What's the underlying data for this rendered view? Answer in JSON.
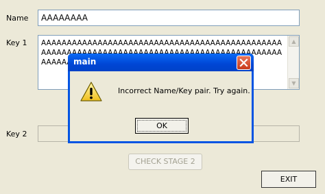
{
  "form": {
    "name_label": "Name",
    "name_value": "AAAAAAAA",
    "key1_label": "Key 1",
    "key1_value": "AAAAAAAAAAAAAAAAAAAAAAAAAAAAAAAAAAAAAAAAAAAAAAAAAAAAAAAAAAAAAAAAAAAAAAAAAAAAAAAAAAAAAAAAAAAAAAAAAAAAAAAAAAAAAAAAAAAAAAAAAAAAAAAAAAAA",
    "key2_label": "Key 2",
    "key2_value": "",
    "check_stage_label": "CHECK STAGE 2",
    "exit_label": "EXIT"
  },
  "dialog": {
    "title": "main",
    "message": "Incorrect Name/Key pair. Try again.",
    "ok_label": "OK",
    "icon": "warning-icon"
  },
  "colors": {
    "background": "#ece9d8",
    "titlebar": "#0054e3",
    "close_button": "#d7502f"
  }
}
